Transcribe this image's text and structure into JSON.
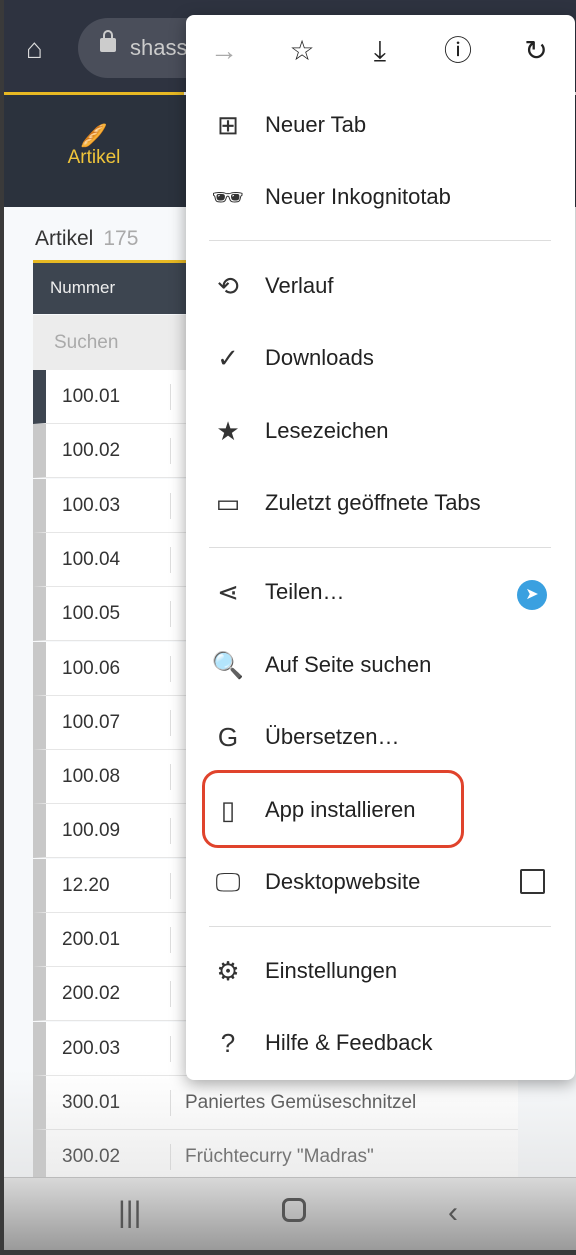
{
  "browser": {
    "url": "shass",
    "toolbar_icons": [
      "forward-arrow",
      "star",
      "download",
      "info",
      "reload"
    ]
  },
  "nav": {
    "active_item": "Artikel",
    "accent": "#f0c53a"
  },
  "page": {
    "title": "Artikel",
    "count": "175",
    "column_header": "Nummer",
    "search_placeholder": "Suchen"
  },
  "rows": [
    {
      "nummer": "100.01",
      "name": ""
    },
    {
      "nummer": "100.02",
      "name": ""
    },
    {
      "nummer": "100.03",
      "name": ""
    },
    {
      "nummer": "100.04",
      "name": ""
    },
    {
      "nummer": "100.05",
      "name": ""
    },
    {
      "nummer": "100.06",
      "name": ""
    },
    {
      "nummer": "100.07",
      "name": ""
    },
    {
      "nummer": "100.08",
      "name": ""
    },
    {
      "nummer": "100.09",
      "name": ""
    },
    {
      "nummer": "12.20",
      "name": ""
    },
    {
      "nummer": "200.01",
      "name": ""
    },
    {
      "nummer": "200.02",
      "name": ""
    },
    {
      "nummer": "200.03",
      "name": ""
    },
    {
      "nummer": "300.01",
      "name": "Paniertes Gemüseschnitzel"
    },
    {
      "nummer": "300.02",
      "name": "Früchtecurry \"Madras\""
    }
  ],
  "menu": {
    "items": [
      {
        "label": "Neuer Tab",
        "icon": "plus-box"
      },
      {
        "label": "Neuer Inkognitotab",
        "icon": "incognito"
      },
      {
        "label": "Verlauf",
        "icon": "history"
      },
      {
        "label": "Downloads",
        "icon": "download-check"
      },
      {
        "label": "Lesezeichen",
        "icon": "star"
      },
      {
        "label": "Zuletzt geöffnete Tabs",
        "icon": "devices"
      },
      {
        "label": "Teilen…",
        "icon": "share"
      },
      {
        "label": "Auf Seite suchen",
        "icon": "find-in-page"
      },
      {
        "label": "Übersetzen…",
        "icon": "translate"
      },
      {
        "label": "App installieren",
        "icon": "install-mobile"
      },
      {
        "label": "Desktopwebsite",
        "icon": "desktop",
        "checked": false
      },
      {
        "label": "Einstellungen",
        "icon": "gear"
      },
      {
        "label": "Hilfe & Feedback",
        "icon": "help"
      }
    ],
    "highlight_color": "#e0432c"
  }
}
